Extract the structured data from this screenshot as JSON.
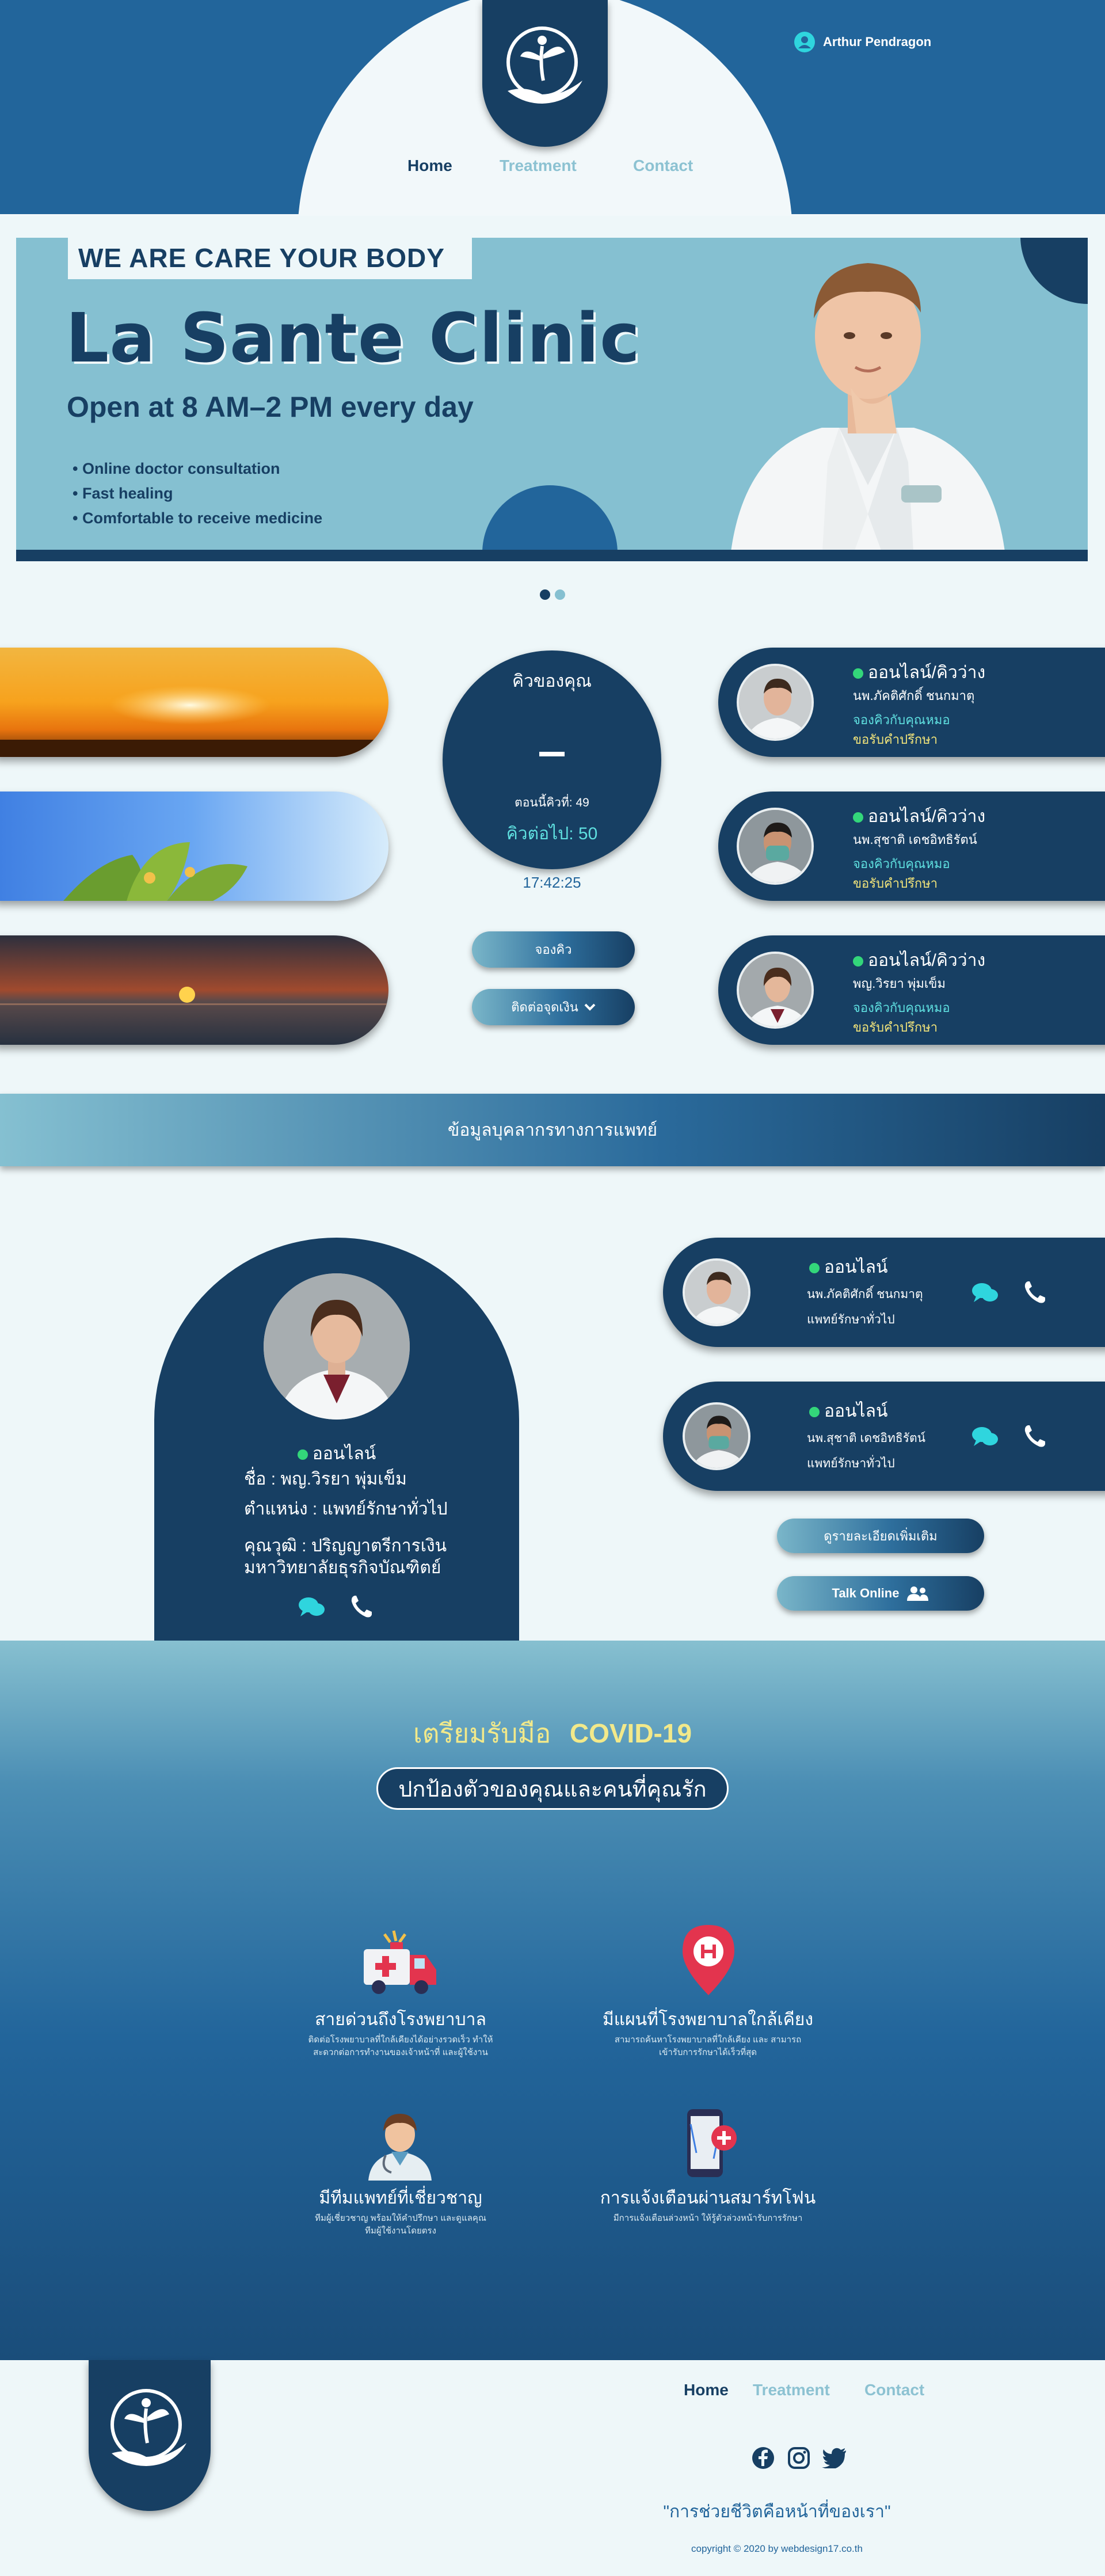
{
  "header": {
    "nav": [
      "Home",
      "Treatment",
      "Contact"
    ],
    "user_name": "Arthur Pendragon"
  },
  "hero": {
    "tag": "WE ARE CARE YOUR BODY",
    "title": "La Sante Clinic",
    "subtitle": "Open at 8 AM–2 PM every day",
    "features": [
      "• Online doctor consultation",
      "• Fast healing",
      "• Comfortable to receive medicine"
    ]
  },
  "queue": {
    "title": "คิวของคุณ",
    "current_label": "ตอนนี้คิวที่: 49",
    "next_label": "คิวต่อไป: 50",
    "time": "17:42:25",
    "book_button": "จองคิว",
    "contact_button": "ติดต่อจุดเงิน"
  },
  "doctor_cards": [
    {
      "status": "ออนไลน์/คิวว่าง",
      "name": "นพ.ภัคติศักดิ์ ชนกมาตุ",
      "link1": "จองคิวกับคุณหมอ",
      "link2": "ขอรับคำปรึกษา"
    },
    {
      "status": "ออนไลน์/คิวว่าง",
      "name": "นพ.สุชาติ เดชอิทธิรัตน์",
      "link1": "จองคิวกับคุณหมอ",
      "link2": "ขอรับคำปรึกษา"
    },
    {
      "status": "ออนไลน์/คิวว่าง",
      "name": "พญ.วิรยา พุ่มเข็ม",
      "link1": "จองคิวกับคุณหมอ",
      "link2": "ขอรับคำปรึกษา"
    }
  ],
  "staff_banner": "ข้อมูลบุคลากรทางการแพทย์",
  "featured_doctor": {
    "status": "ออนไลน์",
    "name": "ชื่อ : พญ.วิรยา พุ่มเข็ม",
    "position": "ตำแหน่ง : แพทย์รักษาทั่วไป",
    "education_1": "คุณวุฒิ : ปริญญาตรีการเงิน",
    "education_2": "มหาวิทยาลัยธุรกิจบัณฑิตย์"
  },
  "online_doctors": [
    {
      "status": "ออนไลน์",
      "name": "นพ.ภัคติศักดิ์ ชนกมาตุ",
      "role": "แพทย์รักษาทั่วไป"
    },
    {
      "status": "ออนไลน์",
      "name": "นพ.สุชาติ เดชอิทธิรัตน์",
      "role": "แพทย์รักษาทั่วไป"
    }
  ],
  "more_button": "ดูรายละเอียดเพิ่มเติม",
  "talk_button": "Talk Online",
  "covid": {
    "title_th": "เตรียมรับมือ",
    "title_en": "COVID-19",
    "subtitle": "ปกป้องตัวของคุณและคนที่คุณรัก",
    "features": [
      {
        "title": "สายด่วนถึงโรงพยาบาล",
        "desc1": "ติดต่อโรงพยาบาลที่ใกล้เคียงได้อย่างรวดเร็ว ทำให้",
        "desc2": "สะดวกต่อการทำงานของเจ้าหน้าที่ และผู้ใช้งาน"
      },
      {
        "title": "มีแผนที่โรงพยาบาลใกล้เคียง",
        "desc1": "สามารถค้นหาโรงพยาบาลที่ใกล้เคียง และ สามารถ",
        "desc2": "เข้ารับการรักษาได้เร็วที่สุด"
      },
      {
        "title": "มีทีมแพทย์ที่เชี่ยวชาญ",
        "desc1": "ทีมผู้เชี่ยวชาญ พร้อมให้คำปรึกษา และดูแลคุณ",
        "desc2": "ทีมผู้ใช้งานโดยตรง"
      },
      {
        "title": "การแจ้งเตือนผ่านสมาร์ทโฟน",
        "desc1": "มีการแจ้งเตือนล่วงหน้า ให้รู้ตัวล่วงหน้ารับการรักษา",
        "desc2": ""
      }
    ]
  },
  "footer": {
    "nav": [
      "Home",
      "Treatment",
      "Contact"
    ],
    "quote": "\"การช่วยชีวิตคือหน้าที่ของเรา\"",
    "copyright": "copyright © 2020 by webdesign17.co.th"
  },
  "colors": {
    "navy": "#173f63",
    "blue": "#22659b",
    "teal": "#85c0d1",
    "online": "#33d67a",
    "yellow": "#f2e47a",
    "cyan": "#5fe0e0"
  }
}
